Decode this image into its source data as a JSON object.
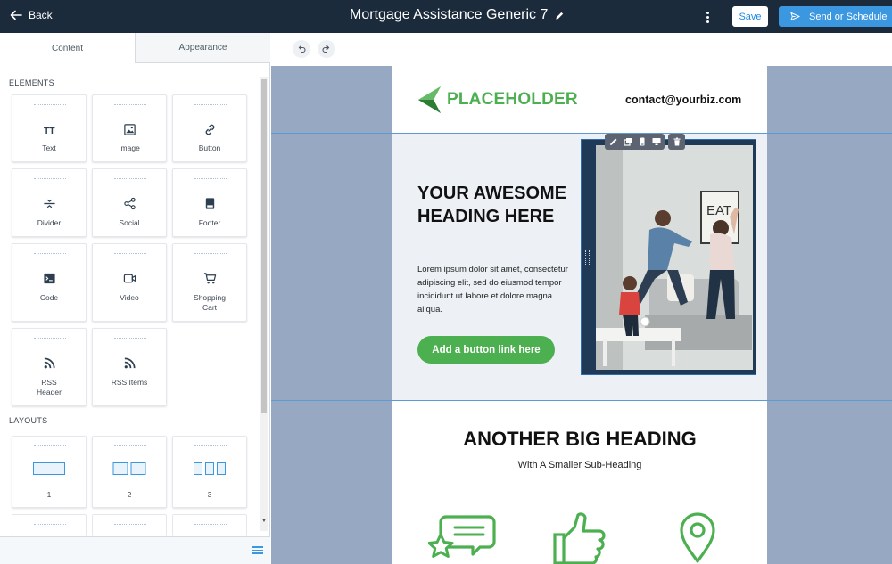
{
  "topbar": {
    "back_label": "Back",
    "title": "Mortgage Assistance Generic 7",
    "save_label": "Save",
    "send_label": "Send or Schedule",
    "accent": "#3a97e0",
    "bg": "#1b2b3c"
  },
  "sidebar": {
    "tabs": [
      {
        "label": "Content",
        "active": true
      },
      {
        "label": "Appearance",
        "active": false
      }
    ],
    "elements_title": "ELEMENTS",
    "elements": [
      {
        "label": "Text",
        "icon": "text-icon"
      },
      {
        "label": "Image",
        "icon": "image-icon"
      },
      {
        "label": "Button",
        "icon": "link-icon"
      },
      {
        "label": "Divider",
        "icon": "divider-icon"
      },
      {
        "label": "Social",
        "icon": "share-icon"
      },
      {
        "label": "Footer",
        "icon": "footer-icon"
      },
      {
        "label": "Code",
        "icon": "terminal-icon"
      },
      {
        "label": "Video",
        "icon": "video-icon"
      },
      {
        "label": "Shopping Cart",
        "icon": "cart-icon"
      },
      {
        "label": "RSS Header",
        "icon": "rss-icon"
      },
      {
        "label": "RSS Items",
        "icon": "rss-icon"
      }
    ],
    "layouts_title": "LAYOUTS",
    "layouts": [
      {
        "label": "1"
      },
      {
        "label": "2"
      },
      {
        "label": "3"
      }
    ]
  },
  "email": {
    "logo_text": "PLACEHOLDER",
    "contact": "contact@yourbiz.com",
    "hero_heading": "YOUR AWESOME HEADING HERE",
    "hero_body": "Lorem ipsum dolor sit amet, consectetur adipiscing elit, sed do eiusmod tempor incididunt ut labore et dolore magna aliqua.",
    "cta_label": "Add a button link here",
    "section_heading": "ANOTHER BIG HEADING",
    "section_subheading": "With A Smaller Sub-Heading",
    "brand_color": "#4caf50"
  }
}
